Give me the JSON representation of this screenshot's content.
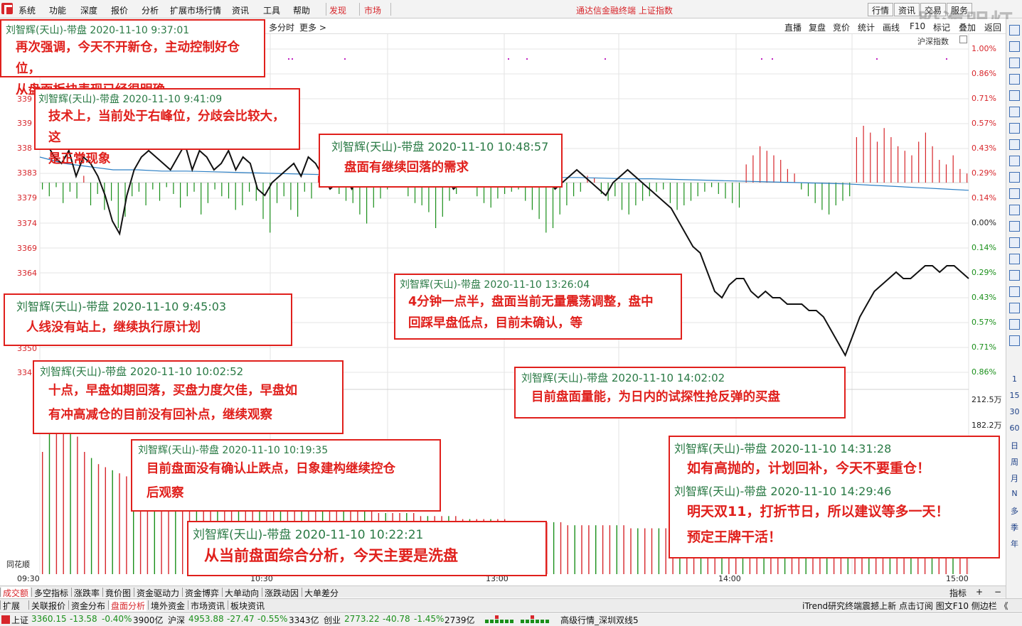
{
  "menu": {
    "items": [
      "系统",
      "功能",
      "深度",
      "报价",
      "分析",
      "扩展市场行情",
      "资讯",
      "工具",
      "帮助"
    ],
    "discover": "发现",
    "market": "市场",
    "title": "通达信金融终端 上证指数",
    "right_buttons": [
      "行情",
      "资讯",
      "交易",
      "服务"
    ],
    "watermark": "股海明灯"
  },
  "toolbar2": {
    "left": [
      "多分时",
      "更多 >"
    ],
    "right": [
      "直播",
      "复盘",
      "竞价",
      "统计",
      "画线",
      "F10",
      "标记",
      "叠加",
      "返回"
    ],
    "index_label": "沪深指数"
  },
  "chart_data": {
    "type": "line",
    "title": "",
    "xlabel": "",
    "ylabel": "",
    "x_ticks": [
      "09:30",
      "10:30",
      "13:00",
      "14:00",
      "15:00"
    ],
    "y_left_ticks": [
      "339",
      "339",
      "338",
      "3383",
      "3379",
      "3374",
      "3369",
      "3364",
      "3350",
      "334"
    ],
    "y_right_pct_ticks": [
      "1.00%",
      "0.86%",
      "0.71%",
      "0.57%",
      "0.43%",
      "0.29%",
      "0.14%",
      "0.00%",
      "0.14%",
      "0.29%",
      "0.43%",
      "0.57%",
      "0.71%",
      "0.86%"
    ],
    "volume_ticks": [
      "212.5万",
      "182.2万"
    ],
    "ylim": [
      3345,
      3395
    ],
    "prev_close": 3374,
    "series": [
      {
        "values": [
          3386,
          3380,
          3378,
          3377,
          3379,
          3375,
          3378,
          3377,
          3375,
          3372,
          3368,
          3366,
          3372,
          3376,
          3378,
          3379,
          3378,
          3377,
          3376,
          3378,
          3380,
          3376,
          3379,
          3378,
          3376,
          3377,
          3379,
          3376,
          3378,
          3377,
          3373,
          3372,
          3374,
          3375,
          3376,
          3377,
          3375,
          3378,
          3377,
          3375,
          3373,
          3374,
          3375,
          3373,
          3375,
          3377,
          3378,
          3376,
          3375,
          3376,
          3377,
          3378,
          3375,
          3376,
          3377,
          3374,
          3375,
          3373,
          3374,
          3376,
          3378,
          3377,
          3375,
          3376,
          3377,
          3379,
          3377,
          3376,
          3375,
          3376,
          3375,
          3373,
          3374,
          3375,
          3376,
          3375,
          3374,
          3373,
          3372,
          3374,
          3375,
          3376,
          3375,
          3374,
          3373,
          3372,
          3371,
          3370,
          3368,
          3366,
          3364,
          3363,
          3360,
          3357,
          3356,
          3358,
          3359,
          3359,
          3357,
          3356,
          3357,
          3356,
          3356,
          3355,
          3355,
          3355,
          3354,
          3354,
          3353,
          3351,
          3349,
          3347,
          3350,
          3353,
          3355,
          3357,
          3358,
          3359,
          3360,
          3359,
          3359,
          3360,
          3361,
          3361,
          3360,
          3361,
          3361,
          3360,
          3359
        ]
      },
      {
        "values": [
          3378,
          3377,
          3376.5,
          3376,
          3376,
          3375.8,
          3375.8,
          3375.7,
          3375.6,
          3375.5,
          3375.4,
          3375.3,
          3375.2,
          3375.1,
          3375,
          3375,
          3375,
          3375,
          3374.9,
          3374.9,
          3374.9,
          3374.8,
          3374.8,
          3374.7,
          3374.6,
          3374.6,
          3374.5,
          3374.4,
          3374.3,
          3374.2,
          3374.1,
          3374,
          3373.9,
          3373.8,
          3373.6,
          3373.4,
          3373.2,
          3373,
          3372.8
        ]
      }
    ],
    "volume_bars": [
      40,
      55,
      62,
      58,
      50,
      45,
      40,
      38,
      36,
      35,
      34,
      33,
      32,
      31,
      31,
      30,
      30,
      29,
      29,
      28,
      28,
      28,
      27,
      27,
      26,
      26,
      26,
      25,
      25,
      25,
      24,
      24,
      24,
      24,
      23,
      23,
      23,
      23,
      22,
      22,
      22,
      22,
      22,
      21,
      21,
      21,
      21,
      21,
      20,
      20,
      20,
      20,
      20,
      20,
      19,
      19,
      19,
      19,
      19,
      19,
      18,
      18,
      18,
      18,
      18,
      18,
      18,
      17,
      17,
      17,
      17,
      17,
      17,
      17,
      17,
      16,
      16,
      16,
      16,
      16,
      16,
      16,
      16,
      16,
      15,
      15,
      15,
      15,
      15,
      15,
      15,
      15,
      15,
      15,
      15,
      14,
      14,
      14,
      14,
      14,
      14,
      14,
      14,
      14,
      14,
      14,
      14,
      14,
      14,
      14,
      13,
      13,
      13,
      13,
      13,
      13,
      13,
      13,
      13,
      13,
      13,
      13,
      13,
      13,
      13,
      13,
      14,
      14,
      14,
      15,
      16,
      18,
      20
    ],
    "breadth_bars": [
      -3,
      -6,
      -2,
      -9,
      -4,
      -7,
      3,
      -10,
      -5,
      -12,
      -8,
      -20,
      -15,
      -6,
      -4,
      -10,
      -3,
      -8,
      -2,
      -5,
      -11,
      -6,
      -4,
      -14,
      -9,
      -3,
      -6,
      -7,
      -12,
      -10,
      -4,
      -8,
      -16,
      -22,
      -9,
      -6,
      -12,
      -15,
      -4,
      -7,
      3,
      6,
      -2,
      -5,
      -8,
      -9,
      -14,
      -18,
      -11,
      -7,
      -3,
      5,
      -2,
      -6,
      -9,
      -10,
      -13,
      -20,
      -15,
      -8,
      -5,
      6,
      4,
      -6,
      -9,
      -11,
      -7,
      -5,
      -4,
      -3,
      -8,
      -12,
      -16,
      -22,
      -20,
      -14,
      -10,
      -6,
      -4,
      3,
      2,
      -5,
      -8,
      -6,
      -12,
      -14,
      -10,
      -8,
      -6,
      -4,
      -3,
      -9,
      -12,
      -10,
      -8,
      -6,
      -4,
      -2,
      -5,
      -7,
      -9,
      -11,
      8,
      12,
      16,
      14,
      12,
      10,
      6,
      4,
      -3,
      -6,
      -9,
      -12,
      -14,
      -10,
      -8,
      -6,
      20,
      25,
      22,
      18,
      24,
      20,
      16,
      14,
      12,
      18,
      22,
      16,
      10,
      8,
      12,
      6,
      4
    ]
  },
  "annotations": [
    {
      "head": "刘智辉(天山)-带盘 2020-11-10 9:37:01",
      "body": [
        "再次强调，今天不开新仓，主动控制好仓位，",
        "从盘面板块表现已经很明确"
      ]
    },
    {
      "head": "刘智辉(天山)-带盘 2020-11-10 9:41:09",
      "body": [
        "技术上，当前处于右峰位，分歧会比较大，这",
        "是正常现象"
      ]
    },
    {
      "head": "刘智辉(天山)-带盘 2020-11-10 10:48:57",
      "body": [
        "盘面有继续回落的需求"
      ]
    },
    {
      "head": "刘智辉(天山)-带盘 2020-11-10 9:45:03",
      "body": [
        "人线没有站上，继续执行原计划"
      ]
    },
    {
      "head": "刘智辉(天山)-带盘 2020-11-10 13:26:04",
      "body": [
        "4分钟一点半，盘面当前无量震荡调整，盘中",
        "回踩早盘低点，目前未确认，等"
      ]
    },
    {
      "head": "刘智辉(天山)-带盘 2020-11-10 10:02:52",
      "body": [
        "十点，早盘如期回落，买盘力度欠佳，早盘如",
        "有冲高减仓的目前没有回补点，继续观察"
      ]
    },
    {
      "head": "刘智辉(天山)-带盘 2020-11-10 14:02:02",
      "body": [
        "目前盘面量能，为日内的试探性抢反弹的买盘"
      ]
    },
    {
      "head": "刘智辉(天山)-带盘 2020-11-10 10:19:35",
      "body": [
        "目前盘面没有确认止跌点，日象建构继续控仓",
        "后观察"
      ]
    },
    {
      "head": "刘智辉(天山)-带盘 2020-11-10 10:22:21",
      "body": [
        "从当前盘面综合分析，今天主要是洗盘"
      ]
    },
    {
      "head": "刘智辉(天山)-带盘 2020-11-10 14:31:28",
      "body": [
        "如有高抛的，计划回补，今天不要重仓！"
      ],
      "head2": "刘智辉(天山)-带盘 2020-11-10 14:29:46",
      "body2": [
        "明天双11，打折节日，所以建议等多一天！",
        "预定王牌干活！"
      ]
    }
  ],
  "chart_brand": "同花顺",
  "sidebar": {
    "nums": [
      "1",
      "15",
      "30",
      "60",
      "日",
      "周",
      "月",
      "N",
      "多",
      "季",
      "年"
    ]
  },
  "tabs_row1": [
    "成交额",
    "多空指标",
    "涨跌率",
    "竟价图",
    "资金驱动力",
    "资金博弈",
    "大单动向",
    "涨跌动因",
    "大单差分"
  ],
  "tabs_row1_right": [
    "指标",
    "+",
    "−"
  ],
  "tabs_row2": [
    "扩展",
    "关联报价",
    "资金分布",
    "盘面分析",
    "境外资金",
    "市场资讯",
    "板块资讯"
  ],
  "tabs_row2_right": "iTrend研究终端震撼上新 点击订阅  图文F10  侧边栏 《",
  "status": {
    "sh_name": "上证",
    "sh_val": "3360.15",
    "sh_chg": "-13.58",
    "sh_pct": "-0.40%",
    "sh_amt": "3900亿",
    "hs_name": "沪深",
    "hs_val": "4953.88",
    "hs_chg": "-27.47",
    "hs_pct": "-0.55%",
    "hs_amt": "3343亿",
    "cy_name": "创业",
    "cy_val": "2773.22",
    "cy_chg": "-40.78",
    "cy_pct": "-1.45%",
    "cy_amt": "2739亿",
    "feed": "高级行情_深圳双线5"
  },
  "colors": {
    "up": "#d7262b",
    "down": "#1a8f1a",
    "price_line": "#111111",
    "avg_line": "#2c7fc4",
    "anno_border": "#e0201c",
    "anno_head": "#2a7a45"
  }
}
